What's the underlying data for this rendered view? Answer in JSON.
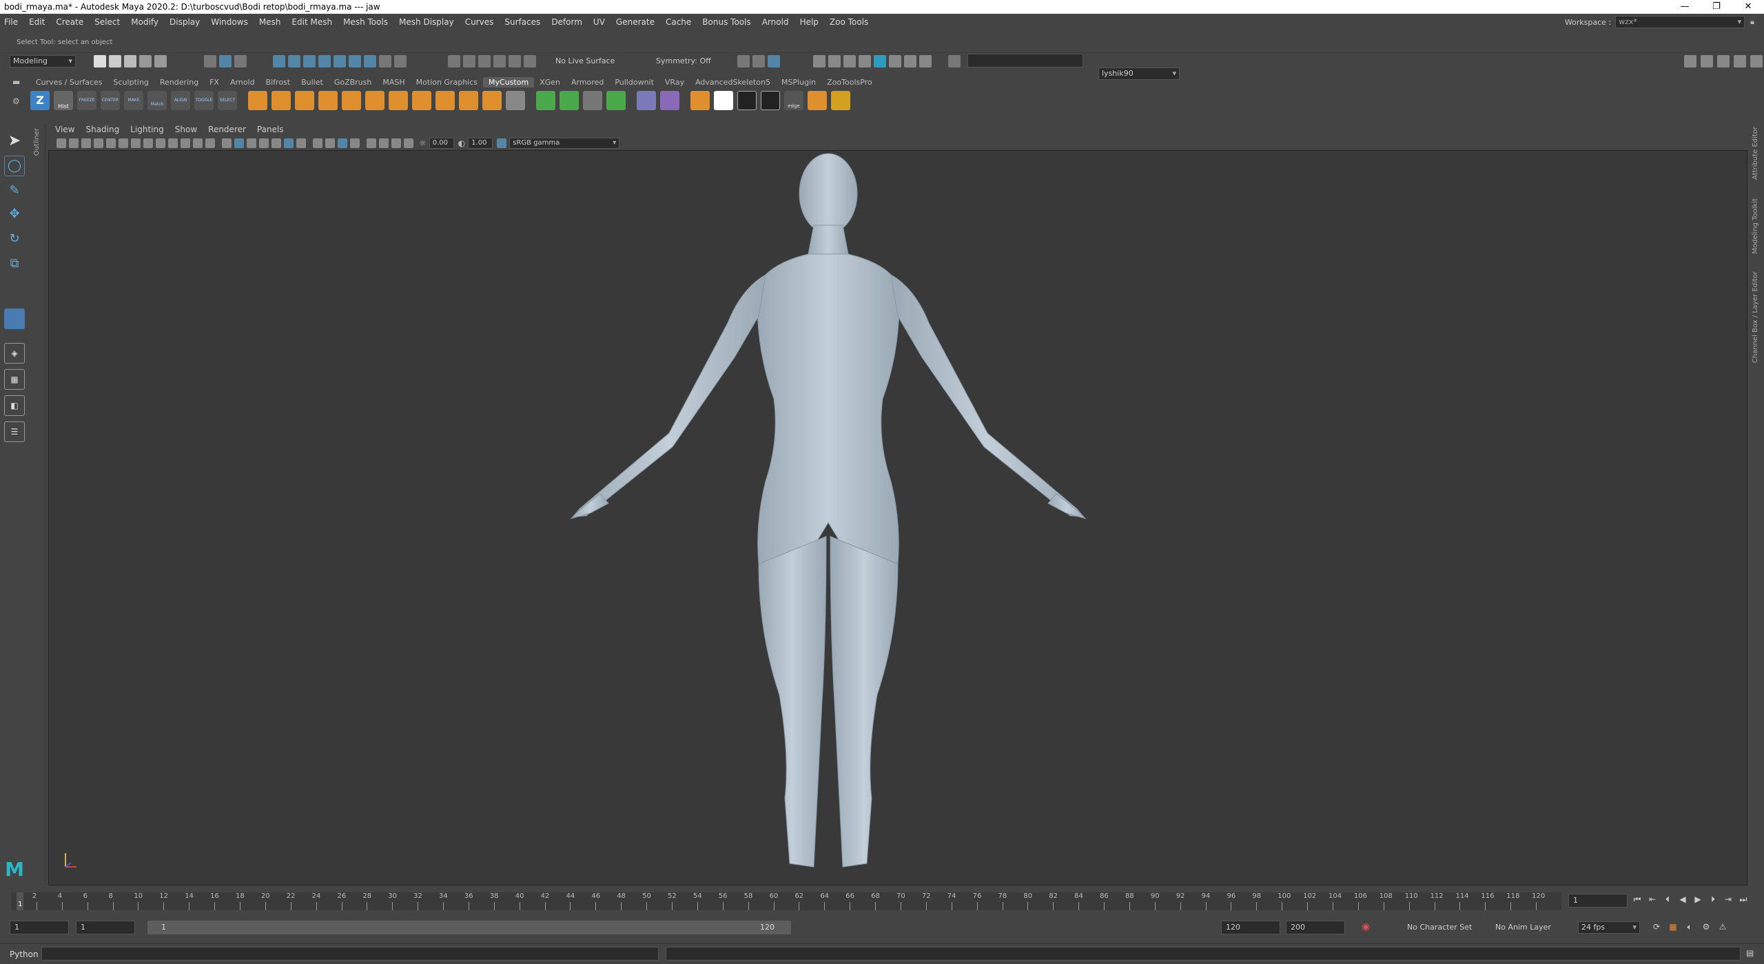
{
  "window": {
    "title": "bodi_rmaya.ma* - Autodesk Maya 2020.2: D:\\turboscvud\\Bodi retop\\bodi_rmaya.ma  ---  jaw",
    "minimize": "—",
    "maximize": "❐",
    "close": "✕"
  },
  "menubar": {
    "items": [
      "File",
      "Edit",
      "Create",
      "Select",
      "Modify",
      "Display",
      "Windows",
      "Mesh",
      "Edit Mesh",
      "Mesh Tools",
      "Mesh Display",
      "Curves",
      "Surfaces",
      "Deform",
      "UV",
      "Generate",
      "Cache",
      "Bonus Tools",
      "Arnold",
      "Help",
      "Zoo Tools"
    ],
    "workspace_label": "Workspace :",
    "workspace_value": "wzx*"
  },
  "help_line": "Select Tool: select an object",
  "status_line": {
    "menu_set": "Modeling",
    "live_surface": "No Live Surface",
    "symmetry": "Symmetry: Off",
    "user": "lyshik90"
  },
  "shelf": {
    "tabs": [
      "Curves / Surfaces",
      "Sculpting",
      "Rendering",
      "FX",
      "Arnold",
      "Bifrost",
      "Bullet",
      "GoZBrush",
      "MASH",
      "Motion Graphics",
      "MyCustom",
      "XGen",
      "Armored",
      "Pulldownit",
      "VRay",
      "AdvancedSkeleton5",
      "MSPlugin",
      "ZooToolsPro"
    ],
    "active_tab": "MyCustom",
    "button_labels": [
      "Hist",
      "FREEZE",
      "CENTER",
      "MAKE",
      "Match",
      "ALIGN",
      "TOGGLE",
      "SELECT",
      "edge"
    ]
  },
  "panel": {
    "menu": [
      "View",
      "Shading",
      "Lighting",
      "Show",
      "Renderer",
      "Panels"
    ],
    "exposure": "0.00",
    "gamma": "1.00",
    "color_space": "sRGB gamma"
  },
  "side_labels": {
    "outliner": "Outliner",
    "attribute_editor": "Attribute Editor",
    "modeling_toolkit": "Modeling Toolkit",
    "channel_box": "Channel Box / Layer Editor"
  },
  "timeline": {
    "ticks": [
      "2",
      "4",
      "6",
      "8",
      "10",
      "12",
      "14",
      "16",
      "18",
      "20",
      "22",
      "24",
      "26",
      "28",
      "30",
      "32",
      "34",
      "36",
      "38",
      "40",
      "42",
      "44",
      "46",
      "48",
      "50",
      "52",
      "54",
      "56",
      "58",
      "60",
      "62",
      "64",
      "66",
      "68",
      "70",
      "72",
      "74",
      "76",
      "78",
      "80",
      "82",
      "84",
      "86",
      "88",
      "90",
      "92",
      "94",
      "96",
      "98",
      "100",
      "102",
      "104",
      "106",
      "108",
      "110",
      "112",
      "114",
      "116",
      "118",
      "120"
    ],
    "current_frame_marker": "1",
    "current_frame": "1"
  },
  "range": {
    "start": "1",
    "playback_start": "1",
    "slider_start": "1",
    "slider_end": "120",
    "playback_end": "120",
    "end": "200",
    "character_set": "No Character Set",
    "anim_layer": "No Anim Layer",
    "fps": "24 fps"
  },
  "command_line": {
    "language": "Python"
  },
  "logo": "M"
}
